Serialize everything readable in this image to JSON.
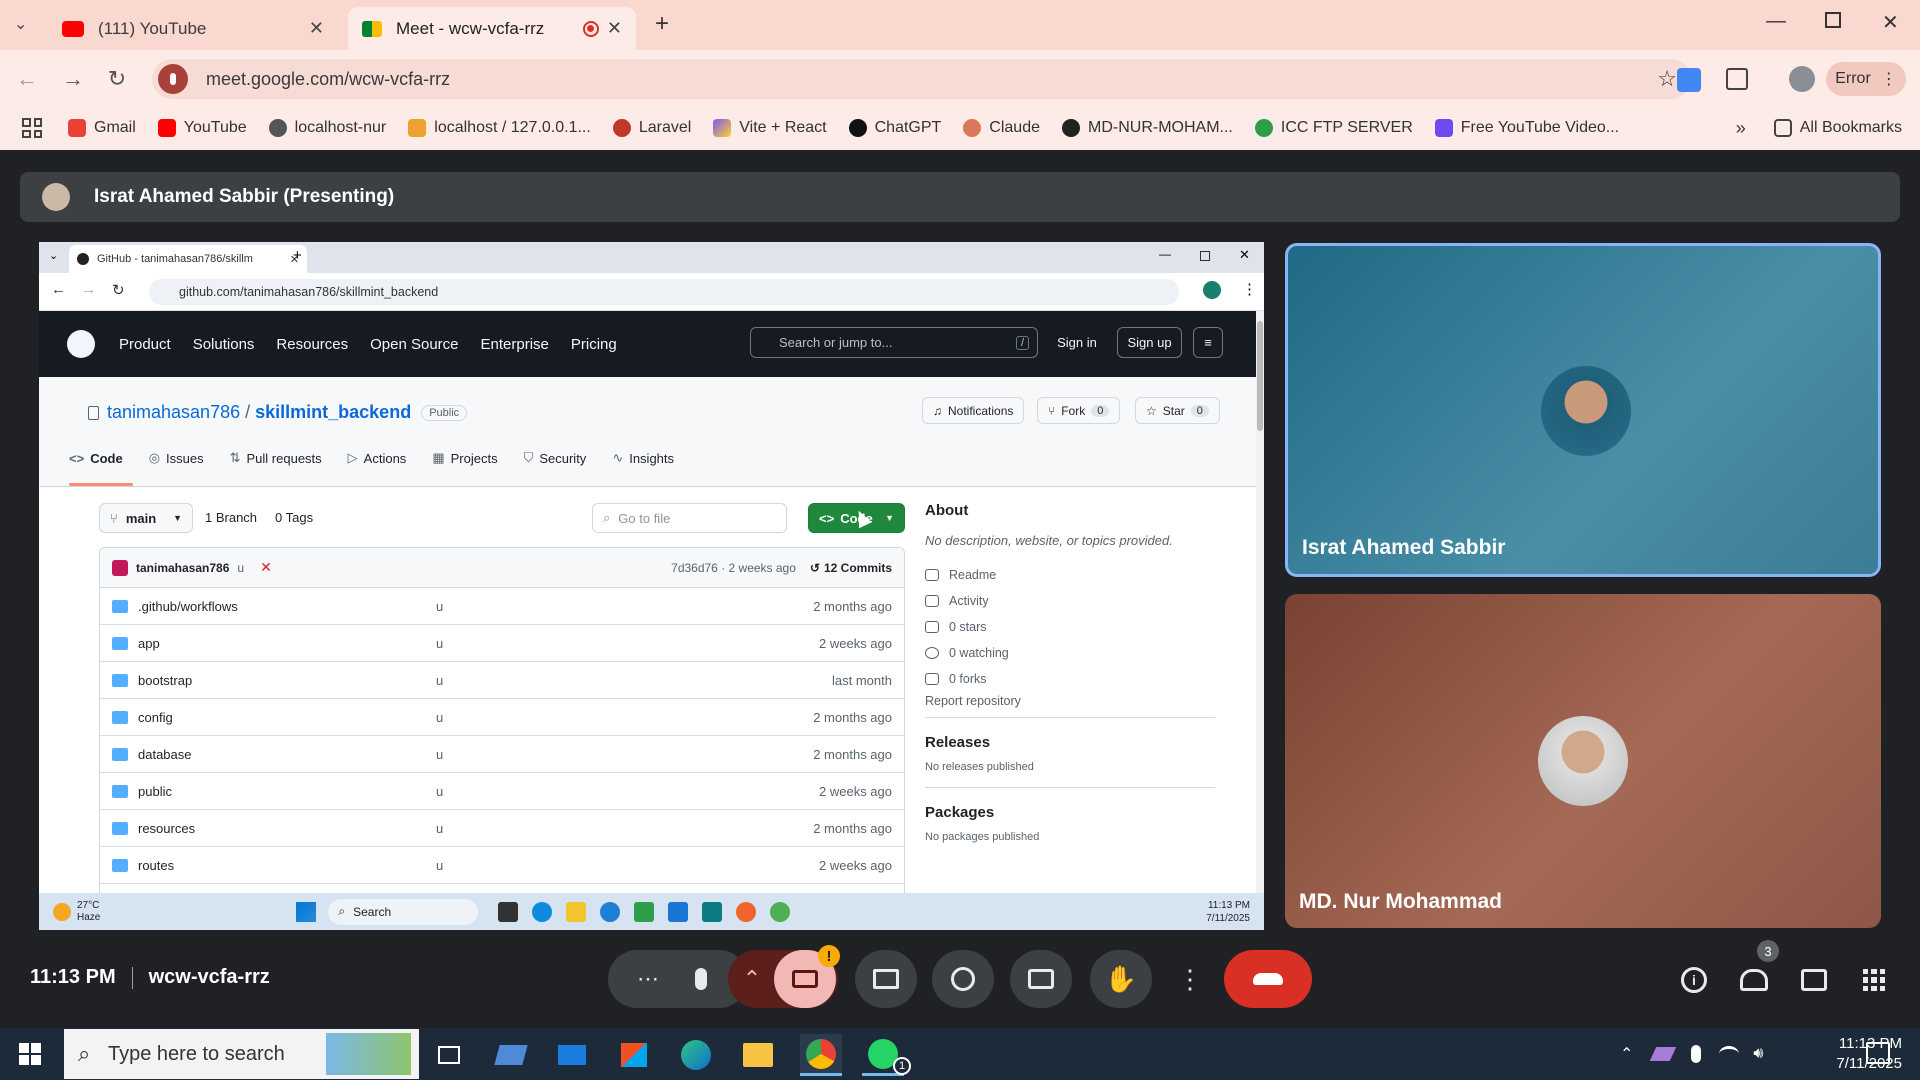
{
  "browser": {
    "tabs": [
      {
        "title": "(111) YouTube"
      },
      {
        "title": "Meet - wcw-vcfa-rrz"
      }
    ],
    "url": "meet.google.com/wcw-vcfa-rrz",
    "profile_label": "Error",
    "bookmarks": [
      "Gmail",
      "YouTube",
      "localhost-nur",
      "localhost / 127.0.0.1...",
      "Laravel",
      "Vite + React",
      "ChatGPT",
      "Claude",
      "MD-NUR-MOHAM...",
      "ICC FTP SERVER",
      "Free YouTube Video..."
    ],
    "all_bookmarks": "All Bookmarks"
  },
  "meet": {
    "presenter_banner": "Israt Ahamed Sabbir (Presenting)",
    "time": "11:13 PM",
    "meeting_code": "wcw-vcfa-rrz",
    "participant_count": "3",
    "participants": [
      {
        "name": "Israt Ahamed Sabbir"
      },
      {
        "name": "MD. Nur Mohammad"
      }
    ]
  },
  "shared": {
    "tab_title": "GitHub - tanimahasan786/skillm",
    "url": "github.com/tanimahasan786/skillmint_backend",
    "nav": [
      "Product",
      "Solutions",
      "Resources",
      "Open Source",
      "Enterprise",
      "Pricing"
    ],
    "search": "Search or jump to...",
    "search_key": "/",
    "sign_in": "Sign in",
    "sign_up": "Sign up",
    "owner": "tanimahasan786",
    "slash": "/",
    "repo": "skillmint_backend",
    "visibility": "Public",
    "notifications": "Notifications",
    "fork": "Fork",
    "fork_count": "0",
    "star": "Star",
    "star_count": "0",
    "repo_tabs": [
      "Code",
      "Issues",
      "Pull requests",
      "Actions",
      "Projects",
      "Security",
      "Insights"
    ],
    "branch": "main",
    "branches": "1 Branch",
    "tags": "0 Tags",
    "go_to_file": "Go to file",
    "code_button": "Code",
    "commit": {
      "author": "tanimahasan786",
      "message": "u",
      "hash_time": "7d36d76 · 2 weeks ago",
      "commits": "12 Commits"
    },
    "files": [
      {
        "name": ".github/workflows",
        "msg": "u",
        "time": "2 months ago"
      },
      {
        "name": "app",
        "msg": "u",
        "time": "2 weeks ago"
      },
      {
        "name": "bootstrap",
        "msg": "u",
        "time": "last month"
      },
      {
        "name": "config",
        "msg": "u",
        "time": "2 months ago"
      },
      {
        "name": "database",
        "msg": "u",
        "time": "2 months ago"
      },
      {
        "name": "public",
        "msg": "u",
        "time": "2 weeks ago"
      },
      {
        "name": "resources",
        "msg": "u",
        "time": "2 months ago"
      },
      {
        "name": "routes",
        "msg": "u",
        "time": "2 weeks ago"
      }
    ],
    "about": {
      "title": "About",
      "description": "No description, website, or topics provided.",
      "stats": [
        "Readme",
        "Activity",
        "0 stars",
        "0 watching",
        "0 forks"
      ],
      "report": "Report repository",
      "releases": "Releases",
      "no_releases": "No releases published",
      "packages": "Packages",
      "no_packages": "No packages published"
    },
    "taskbar": {
      "weather_temp": "27°C",
      "weather_desc": "Haze",
      "search": "Search",
      "time": "11:13 PM",
      "date": "7/11/2025"
    }
  },
  "windows": {
    "search_placeholder": "Type here to search",
    "time": "11:13 PM",
    "date": "7/11/2025",
    "whatsapp_badge": "1"
  }
}
